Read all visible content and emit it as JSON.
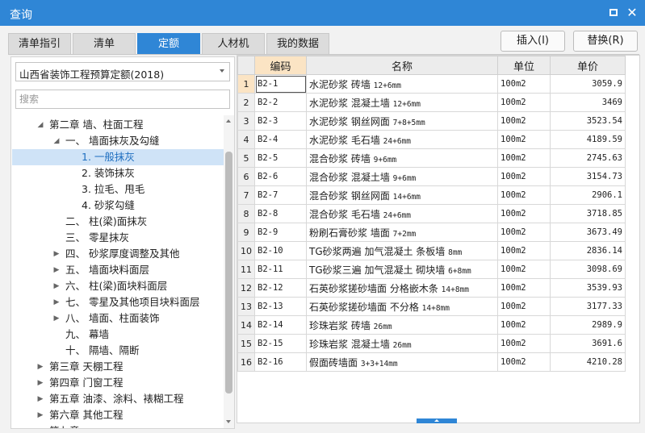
{
  "window": {
    "title": "查询",
    "maximize_icon": "maximize-icon",
    "close_icon": "close-icon"
  },
  "tabs": [
    {
      "label": "清单指引",
      "active": false
    },
    {
      "label": "清单",
      "active": false
    },
    {
      "label": "定额",
      "active": true
    },
    {
      "label": "人材机",
      "active": false
    },
    {
      "label": "我的数据",
      "active": false
    }
  ],
  "actions": {
    "insert_label": "插入(I)",
    "replace_label": "替换(R)"
  },
  "left": {
    "quota_library": "山西省装饰工程预算定额(2018)",
    "search_placeholder": "搜索",
    "tree": [
      {
        "label": "第二章 墙、柱面工程",
        "level": 0,
        "expanded": true,
        "has_children": true
      },
      {
        "label": "一、 墙面抹灰及勾缝",
        "level": 1,
        "expanded": true,
        "has_children": true
      },
      {
        "label": "1. 一般抹灰",
        "level": 2,
        "selected": true,
        "has_children": false
      },
      {
        "label": "2. 装饰抹灰",
        "level": 2,
        "has_children": false
      },
      {
        "label": "3. 拉毛、甩毛",
        "level": 2,
        "has_children": false
      },
      {
        "label": "4. 砂浆勾缝",
        "level": 2,
        "has_children": false
      },
      {
        "label": "二、 柱(梁)面抹灰",
        "level": 1,
        "has_children": false
      },
      {
        "label": "三、 零星抹灰",
        "level": 1,
        "has_children": false
      },
      {
        "label": "四、 砂浆厚度调整及其他",
        "level": 1,
        "has_children": true
      },
      {
        "label": "五、 墙面块料面层",
        "level": 1,
        "has_children": true
      },
      {
        "label": "六、 柱(梁)面块料面层",
        "level": 1,
        "has_children": true
      },
      {
        "label": "七、 零星及其他项目块料面层",
        "level": 1,
        "has_children": true
      },
      {
        "label": "八、 墙面、柱面装饰",
        "level": 1,
        "has_children": true
      },
      {
        "label": "九、 幕墙",
        "level": 1,
        "has_children": false
      },
      {
        "label": "十、 隔墙、隔断",
        "level": 1,
        "has_children": false
      },
      {
        "label": "第三章 天棚工程",
        "level": 0,
        "has_children": true
      },
      {
        "label": "第四章 门窗工程",
        "level": 0,
        "has_children": true
      },
      {
        "label": "第五章 油漆、涂料、裱糊工程",
        "level": 0,
        "has_children": true
      },
      {
        "label": "第六章 其他工程",
        "level": 0,
        "has_children": true
      },
      {
        "label": "第七章 ...",
        "level": 0,
        "has_children": true
      }
    ]
  },
  "table": {
    "columns": [
      "编码",
      "名称",
      "单位",
      "单价"
    ],
    "rows": [
      {
        "idx": "1",
        "code": "B2-1",
        "name": "水泥砂浆 砖墙",
        "spec": "12+6mm",
        "unit": "100m2",
        "price": "3059.9"
      },
      {
        "idx": "2",
        "code": "B2-2",
        "name": "水泥砂浆 混凝土墙",
        "spec": "12+6mm",
        "unit": "100m2",
        "price": "3469"
      },
      {
        "idx": "3",
        "code": "B2-3",
        "name": "水泥砂浆 钢丝网面",
        "spec": "7+8+5mm",
        "unit": "100m2",
        "price": "3523.54"
      },
      {
        "idx": "4",
        "code": "B2-4",
        "name": "水泥砂浆 毛石墙",
        "spec": "24+6mm",
        "unit": "100m2",
        "price": "4189.59"
      },
      {
        "idx": "5",
        "code": "B2-5",
        "name": "混合砂浆 砖墙",
        "spec": "9+6mm",
        "unit": "100m2",
        "price": "2745.63"
      },
      {
        "idx": "6",
        "code": "B2-6",
        "name": "混合砂浆 混凝土墙",
        "spec": "9+6mm",
        "unit": "100m2",
        "price": "3154.73"
      },
      {
        "idx": "7",
        "code": "B2-7",
        "name": "混合砂浆 钢丝网面",
        "spec": "14+6mm",
        "unit": "100m2",
        "price": "2906.1"
      },
      {
        "idx": "8",
        "code": "B2-8",
        "name": "混合砂浆 毛石墙",
        "spec": "24+6mm",
        "unit": "100m2",
        "price": "3718.85"
      },
      {
        "idx": "9",
        "code": "B2-9",
        "name": "粉刷石膏砂浆 墙面",
        "spec": "7+2mm",
        "unit": "100m2",
        "price": "3673.49"
      },
      {
        "idx": "10",
        "code": "B2-10",
        "name": "TG砂浆两遍 加气混凝土 条板墙",
        "spec": "8mm",
        "unit": "100m2",
        "price": "2836.14"
      },
      {
        "idx": "11",
        "code": "B2-11",
        "name": "TG砂浆三遍 加气混凝土 砌块墙",
        "spec": "6+8mm",
        "unit": "100m2",
        "price": "3098.69"
      },
      {
        "idx": "12",
        "code": "B2-12",
        "name": "石英砂浆搓砂墙面 分格嵌木条",
        "spec": "14+8mm",
        "unit": "100m2",
        "price": "3539.93"
      },
      {
        "idx": "13",
        "code": "B2-13",
        "name": "石英砂浆搓砂墙面 不分格",
        "spec": "14+8mm",
        "unit": "100m2",
        "price": "3177.33"
      },
      {
        "idx": "14",
        "code": "B2-14",
        "name": "珍珠岩浆 砖墙",
        "spec": "26mm",
        "unit": "100m2",
        "price": "2989.9"
      },
      {
        "idx": "15",
        "code": "B2-15",
        "name": "珍珠岩浆 混凝土墙",
        "spec": "26mm",
        "unit": "100m2",
        "price": "3691.6"
      },
      {
        "idx": "16",
        "code": "B2-16",
        "name": "假面砖墙面",
        "spec": "3+3+14mm",
        "unit": "100m2",
        "price": "4210.28"
      }
    ]
  }
}
